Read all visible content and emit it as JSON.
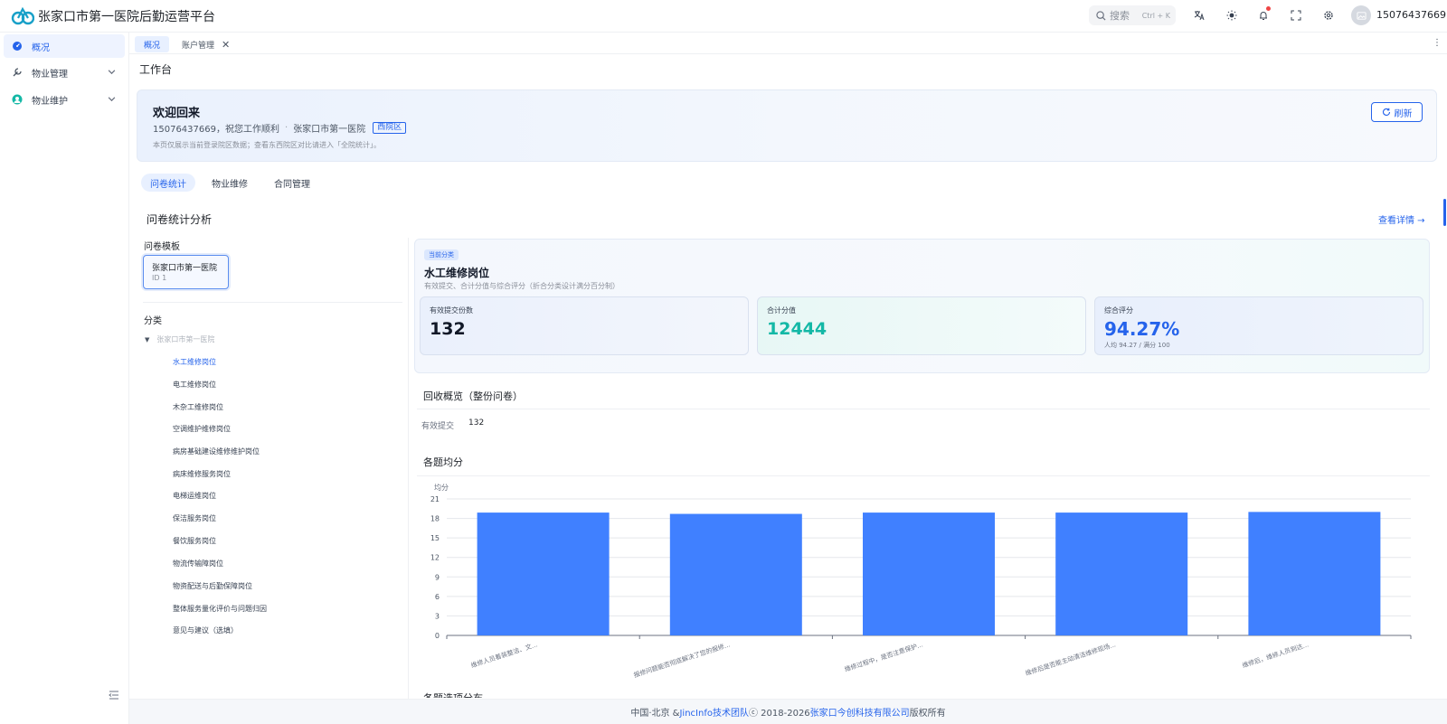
{
  "app": {
    "title": "张家口市第一医院后勤运营平台"
  },
  "header": {
    "search_label": "搜索",
    "search_shortcut": "Ctrl + K",
    "username": "15076437669"
  },
  "sidebar": {
    "items": [
      {
        "label": "概况",
        "icon": "dashboard-icon"
      },
      {
        "label": "物业管理",
        "icon": "wrench-icon"
      },
      {
        "label": "物业维护",
        "icon": "maintenance-icon"
      }
    ]
  },
  "tabs": [
    {
      "label": "概况"
    },
    {
      "label": "账户管理"
    }
  ],
  "page_title": "工作台",
  "welcome": {
    "title": "欢迎回来",
    "greeting": "15076437669，祝您工作顺利",
    "separator": "·",
    "hospital": "张家口市第一医院",
    "campus_badge": "西院区",
    "note": "本页仅展示当前登录院区数据；查看东西院区对比请进入「全院统计」。",
    "refresh_label": "刷新"
  },
  "section_tabs": [
    {
      "label": "问卷统计"
    },
    {
      "label": "物业维修"
    },
    {
      "label": "合同管理"
    }
  ],
  "analysis": {
    "title": "问卷统计分析",
    "detail_link": "查看详情 →",
    "template_label": "问卷模板",
    "template": {
      "name": "张家口市第一医院",
      "id": "ID 1"
    },
    "category_label": "分类",
    "tree_root": "张家口市第一医院",
    "tree_items": [
      "水工维修岗位",
      "电工维修岗位",
      "木杂工维修岗位",
      "空调维护维修岗位",
      "病房基础建设维修维护岗位",
      "病床维修服务岗位",
      "电梯运维岗位",
      "保洁服务岗位",
      "餐饮服务岗位",
      "物流传输障岗位",
      "物资配送与后勤保障岗位",
      "整体服务量化评价与问题归因",
      "意见与建议（选填）"
    ]
  },
  "category": {
    "badge": "当前分类",
    "name": "水工维修岗位",
    "desc": "有效提交、合计分值与综合评分（折合分类设计满分百分制）",
    "stats": {
      "submissions_label": "有效提交份数",
      "submissions": "132",
      "total_label": "合计分值",
      "total": "12444",
      "score_label": "综合评分",
      "score": "94.27%",
      "score_sub": "人均 94.27 / 满分 100"
    }
  },
  "recovery": {
    "title": "回收概览（整份问卷）",
    "key": "有效提交",
    "value": "132"
  },
  "avg_title": "各题均分",
  "next_title": "各题选项分布",
  "chart_data": {
    "type": "bar",
    "ylabel": "均分",
    "ylim": [
      0,
      21
    ],
    "yticks": [
      "0",
      "3",
      "6",
      "9",
      "12",
      "15",
      "18",
      "21"
    ],
    "categories": [
      "维修人员着装整洁、文...",
      "报修问题能否彻底解决了您的报修...",
      "维修过程中，是否注意保护...",
      "维修后是否能主动清洁维修现场...",
      "维修后，维修人员到达..."
    ],
    "values": [
      18.9,
      18.7,
      18.9,
      18.9,
      19.0
    ],
    "colors": {
      "bar": "#4080ff"
    }
  },
  "footer": {
    "prefix": "中国·北京 & ",
    "team": "JincInfo技术团队",
    "middle": " ⓒ 2018-2026 ",
    "company": "张家口今创科技有限公司",
    "suffix": " 版权所有"
  }
}
